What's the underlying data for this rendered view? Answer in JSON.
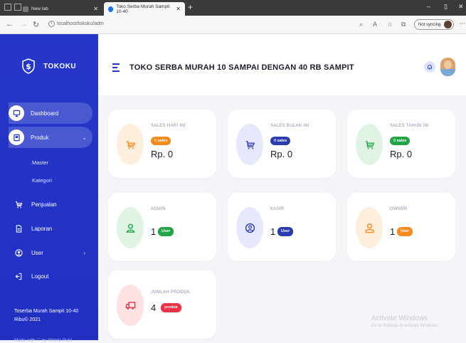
{
  "browser": {
    "tabs": [
      {
        "label": "New tab"
      },
      {
        "label": "Toko Serba Murah Sampit 10-40"
      }
    ],
    "url": "localhost/tokoku/adm",
    "sync_label": "Not syncing"
  },
  "sidebar": {
    "brand": "TOKOKU",
    "items": [
      {
        "label": "Dashboard",
        "icon": "monitor-icon"
      },
      {
        "label": "Produk",
        "icon": "box-icon"
      },
      {
        "label": "Master"
      },
      {
        "label": "Kategori"
      },
      {
        "label": "Penjualan",
        "icon": "cart-icon"
      },
      {
        "label": "Laporan",
        "icon": "document-icon"
      },
      {
        "label": "User",
        "icon": "user-circle-icon"
      },
      {
        "label": "Logout",
        "icon": "logout-icon"
      }
    ],
    "footer_line1": "Toserba Murah Sampit 10-40",
    "footer_line2": "Ribu© 2021",
    "footer_credit": "Made with ♡ by Shinta Putri"
  },
  "header": {
    "title": "TOKO SERBA MURAH 10 SAMPAI DENGAN 40 RB SAMPIT"
  },
  "cards": {
    "sales_day": {
      "label": "SALES HARI INI",
      "badge": "0 sales",
      "value": "Rp. 0"
    },
    "sales_month": {
      "label": "SALES BULAN INI",
      "badge": "0 sales",
      "value": "Rp. 0"
    },
    "sales_year": {
      "label": "SALES TAHUN INI",
      "badge": "0 sales",
      "value": "Rp. 0"
    },
    "admin": {
      "label": "ADMIN",
      "count": "1",
      "badge": "User"
    },
    "kasir": {
      "label": "KASIR",
      "count": "1",
      "badge": "User"
    },
    "owner": {
      "label": "OWNER",
      "count": "1",
      "badge": "User"
    },
    "products": {
      "label": "JUMLAH PRODUK",
      "count": "4",
      "badge": "produk"
    }
  },
  "watermark": {
    "line1": "Activate Windows",
    "line2": "Go to Settings to activate Windows."
  },
  "colors": {
    "sidebar": "#2537c9",
    "orange": "#f58a1f",
    "navy": "#2b3bb0",
    "green": "#22a447",
    "red": "#e83245"
  }
}
